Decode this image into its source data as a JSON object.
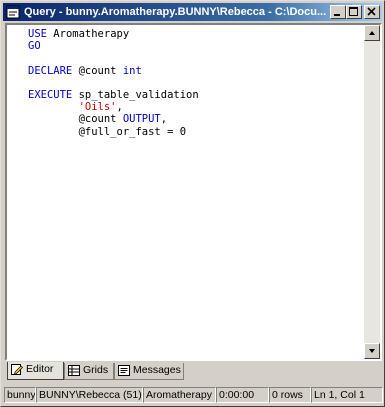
{
  "window": {
    "title": "Query - bunny.Aromatherapy.BUNNY\\Rebecca - C:\\Docu..."
  },
  "editor": {
    "lines": [
      [
        {
          "t": "USE ",
          "c": "kw"
        },
        {
          "t": "Aromatherapy",
          "c": ""
        }
      ],
      [
        {
          "t": "GO",
          "c": "kw"
        }
      ],
      [],
      [
        {
          "t": "DECLARE ",
          "c": "kw"
        },
        {
          "t": "@count ",
          "c": ""
        },
        {
          "t": "int",
          "c": "kw"
        }
      ],
      [],
      [
        {
          "t": "EXECUTE ",
          "c": "kw"
        },
        {
          "t": "sp_table_validation",
          "c": ""
        }
      ],
      [
        {
          "t": "        'Oils'",
          "c": "str"
        },
        {
          "t": ",",
          "c": ""
        }
      ],
      [
        {
          "t": "        @count ",
          "c": ""
        },
        {
          "t": "OUTPUT",
          "c": "kw"
        },
        {
          "t": ",",
          "c": ""
        }
      ],
      [
        {
          "t": "        @full_or_fast = 0",
          "c": ""
        }
      ]
    ]
  },
  "tabs": [
    {
      "label": "Editor",
      "icon": "edit-pencil-icon",
      "active": true
    },
    {
      "label": "Grids",
      "icon": "grid-icon",
      "active": false
    },
    {
      "label": "Messages",
      "icon": "messages-icon",
      "active": false
    }
  ],
  "status": {
    "server": "bunny",
    "user": "BUNNY\\Rebecca (51)",
    "database": "Aromatherapy",
    "elapsed": "0:00:00",
    "rows": "0 rows",
    "position": "Ln 1, Col 1"
  },
  "colors": {
    "title_start": "#0a246a",
    "title_end": "#a6caf0",
    "keyword": "#0000c8",
    "string": "#c80000"
  }
}
